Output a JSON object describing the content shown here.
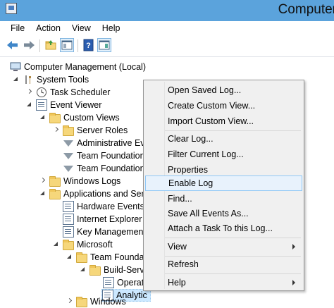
{
  "window": {
    "title": "Computer"
  },
  "menubar": [
    "File",
    "Action",
    "View",
    "Help"
  ],
  "tree": {
    "root": "Computer Management (Local)",
    "system_tools": "System Tools",
    "task_scheduler": "Task Scheduler",
    "event_viewer": "Event Viewer",
    "custom_views": "Custom Views",
    "server_roles": "Server Roles",
    "administrative_events": "Administrative Eve",
    "team_foundation_1": "Team Foundation",
    "team_foundation_2": "Team Foundation",
    "windows_logs": "Windows Logs",
    "apps_services": "Applications and Serv",
    "hardware_events": "Hardware Events",
    "internet_explorer": "Internet Explorer",
    "key_management": "Key Management",
    "microsoft": "Microsoft",
    "team_foundation_3": "Team Foundat",
    "build_service": "Build-Servi",
    "operational": "Operati",
    "analytic": "Analytic",
    "windows": "Windows"
  },
  "context_menu": {
    "open_saved_log": "Open Saved Log...",
    "create_custom_view": "Create Custom View...",
    "import_custom_view": "Import Custom View...",
    "clear_log": "Clear Log...",
    "filter_current_log": "Filter Current Log...",
    "properties": "Properties",
    "enable_log": "Enable Log",
    "find": "Find...",
    "save_all_events_as": "Save All Events As...",
    "attach_task": "Attach a Task To this Log...",
    "view": "View",
    "refresh": "Refresh",
    "help": "Help"
  },
  "colors": {
    "title_bar": "#5ba3dc",
    "selection": "#cce8ff",
    "menu_highlight": "#e8f2fc"
  }
}
